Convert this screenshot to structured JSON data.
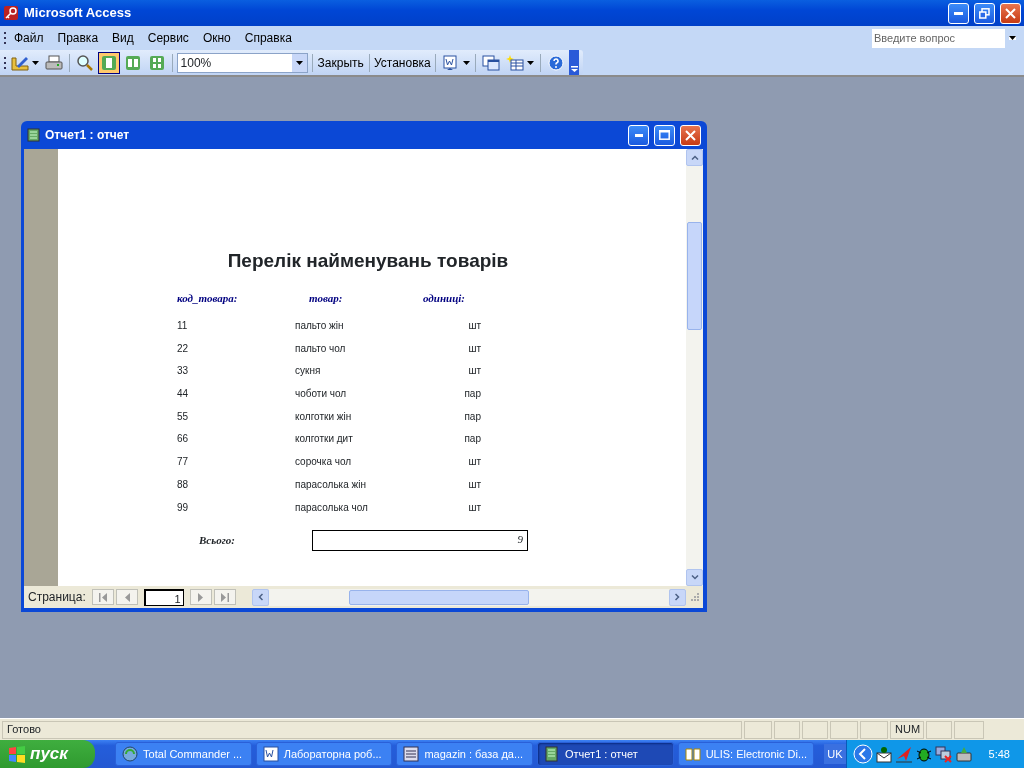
{
  "window": {
    "title": "Microsoft Access"
  },
  "menu": [
    "Файл",
    "Правка",
    "Вид",
    "Сервис",
    "Окно",
    "Справка"
  ],
  "help_box": {
    "placeholder": "Введите вопрос"
  },
  "toolbar": {
    "view_buttons": [
      {
        "kind": "one-page",
        "selected": true
      },
      {
        "kind": "two-pages",
        "selected": false
      },
      {
        "kind": "multiple-pages",
        "selected": false
      }
    ],
    "zoom": "100%",
    "buttons": [
      "Закрыть",
      "Установка"
    ]
  },
  "report_window": {
    "title": "Отчет1 : отчет",
    "report": {
      "title": "Перелік найменувань товарів",
      "columns": [
        "код_товара:",
        "товар:",
        "одиниці:"
      ],
      "rows": [
        [
          "11",
          "пальто жін",
          "шт"
        ],
        [
          "22",
          "пальто чол",
          "шт"
        ],
        [
          "33",
          "сукня",
          "шт"
        ],
        [
          "44",
          "чоботи чол",
          "пар"
        ],
        [
          "55",
          "колготки жін",
          "пар"
        ],
        [
          "66",
          "колготки дит",
          "пар"
        ],
        [
          "77",
          "сорочка чол",
          "шт"
        ],
        [
          "88",
          "парасолька жін",
          "шт"
        ],
        [
          "99",
          "парасолька чол",
          "шт"
        ]
      ],
      "total_label": "Всього:",
      "total_value": "9"
    },
    "navigation": {
      "label": "Страница:",
      "page": "1"
    }
  },
  "status_bar": {
    "text": "Готово",
    "indicator": "NUM"
  },
  "taskbar": {
    "start": "пуск",
    "tasks": [
      {
        "kind": "commander",
        "label": "Total Commander ...",
        "selected": false
      },
      {
        "kind": "word",
        "label": "Лабораторна роб...",
        "selected": false
      },
      {
        "kind": "database",
        "label": "magazin : база да...",
        "selected": false
      },
      {
        "kind": "report",
        "label": "Отчет1 : отчет",
        "selected": true
      },
      {
        "kind": "book",
        "label": "ULIS: Electronic Di...",
        "selected": false
      }
    ],
    "language": "UK",
    "clock": "5:48"
  }
}
